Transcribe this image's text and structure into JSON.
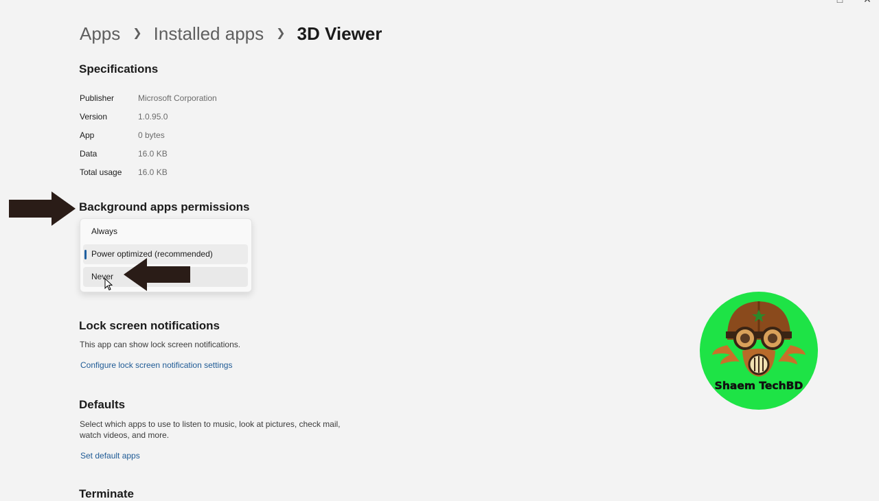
{
  "breadcrumb": {
    "apps": "Apps",
    "installed_apps": "Installed apps",
    "current": "3D Viewer",
    "separator_icon": "chevron-right-icon"
  },
  "specifications": {
    "title": "Specifications",
    "rows": [
      {
        "label": "Publisher",
        "value": "Microsoft Corporation"
      },
      {
        "label": "Version",
        "value": "1.0.95.0"
      },
      {
        "label": "App",
        "value": "0 bytes"
      },
      {
        "label": "Data",
        "value": "16.0 KB"
      },
      {
        "label": "Total usage",
        "value": "16.0 KB"
      }
    ]
  },
  "background_permissions": {
    "title": "Background apps permissions",
    "dropdown": {
      "options": [
        "Always",
        "Power optimized (recommended)",
        "Never"
      ],
      "selected": "Power optimized (recommended)",
      "hovered": "Never"
    }
  },
  "lock_screen": {
    "title": "Lock screen notifications",
    "description": "This app can show lock screen notifications.",
    "link": "Configure lock screen notification settings"
  },
  "defaults": {
    "title": "Defaults",
    "description_line1": "Select which apps to use to listen to music, look at pictures, check mail,",
    "description_line2": "watch videos, and more.",
    "link": "Set default apps"
  },
  "terminate": {
    "title": "Terminate"
  },
  "watermark": {
    "text": "Shaem TechBD",
    "background_color": "#1ee346"
  },
  "annotation_arrow_color": "#2a1c17",
  "accent_color": "#1f5fa0",
  "link_color": "#1e5a95"
}
